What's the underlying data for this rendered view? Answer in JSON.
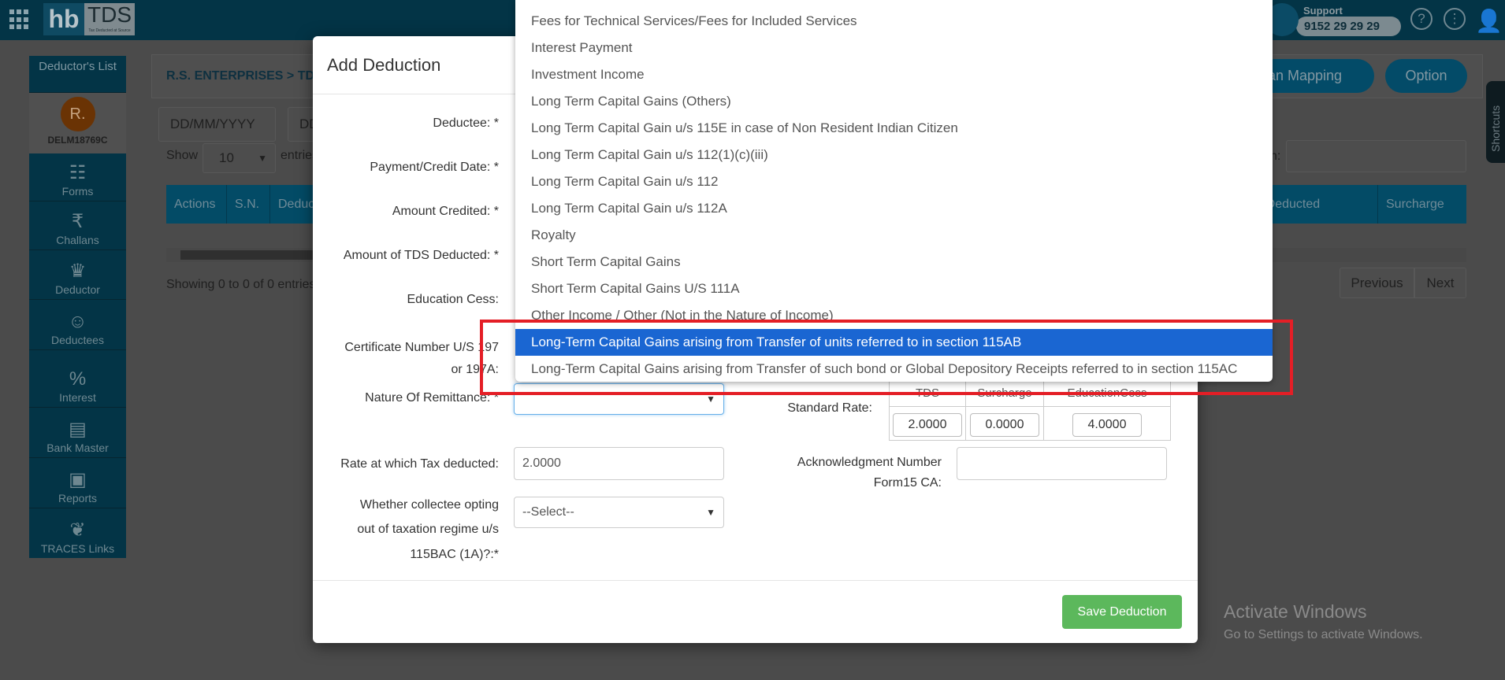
{
  "topbar": {
    "logo_hb": "hb",
    "logo_tds": "TDS",
    "logo_tagline": "Tax Deducted at Source",
    "support_label": "Support",
    "support_phone": "9152 29 29 29",
    "icons": [
      "apps-grid-icon",
      "phone-icon",
      "help-icon",
      "more-vertical-icon",
      "user-icon"
    ]
  },
  "sidebar": {
    "header": "Deductor's List",
    "avatar_initial": "R.",
    "deductor_code": "DELM18769C",
    "items": [
      {
        "label": "Forms",
        "icon": "forms-icon"
      },
      {
        "label": "Challans",
        "icon": "challan-icon"
      },
      {
        "label": "Deductor",
        "icon": "crown-icon"
      },
      {
        "label": "Deductees",
        "icon": "person-icon"
      },
      {
        "label": "Interest",
        "icon": "money-bag-icon"
      },
      {
        "label": "Bank Master",
        "icon": "bank-icon"
      },
      {
        "label": "Reports",
        "icon": "report-icon"
      },
      {
        "label": "TRACES Links",
        "icon": "traces-icon"
      }
    ]
  },
  "page": {
    "breadcrumb": "R.S. ENTERPRISES > TDS",
    "challan_mapping": "llan Mapping",
    "option": "Option",
    "date_from_placeholder": "DD/MM/YYYY",
    "date_to_placeholder": "DD/MM/YYYY",
    "show_label": "Show",
    "page_size": "10",
    "entries_label": "entries",
    "search_label": "n:",
    "columns": [
      "Actions",
      "S.N.",
      "Deduc",
      "DS Deducted",
      "Surcharge"
    ],
    "info": "Showing 0 to 0 of 0 entries",
    "previous": "Previous",
    "next": "Next",
    "shortcuts": "Shortcuts"
  },
  "modal": {
    "title": "Add Deduction",
    "labels": {
      "deductee": "Deductee: *",
      "payment_date": "Payment/Credit Date: *",
      "amount_credited": "Amount Credited: *",
      "tds_deducted": "Amount of TDS Deducted: *",
      "education_cess": "Education Cess:",
      "certificate_1": "Certificate Number U/S 197",
      "certificate_2": "or 197A:",
      "nature": "Nature Of Remittance: *",
      "rate": "Rate at which Tax deducted:",
      "opting_1": "Whether collectee opting",
      "opting_2": "out of taxation regime u/s",
      "opting_3": "115BAC (1A)?:*",
      "standard_rate": "Standard Rate:",
      "ack_1": "Acknowledgment Number",
      "ack_2": "Form15 CA:"
    },
    "rate_value": "2.0000",
    "opting_value": "--Select--",
    "nature_value": "",
    "standard": {
      "headers": [
        "TDS",
        "Surcharge",
        "EducationCess"
      ],
      "values": [
        "2.0000",
        "0.0000",
        "4.0000"
      ]
    },
    "save": "Save Deduction"
  },
  "dropdown": {
    "selected_index": 12,
    "options": [
      "Fees for Technical Services/Fees for Included Services",
      "Interest Payment",
      "Investment Income",
      "Long Term Capital Gains (Others)",
      "Long Term Capital Gain u/s 115E in case of Non Resident Indian Citizen",
      "Long Term Capital Gain u/s 112(1)(c)(iii)",
      "Long Term Capital Gain u/s 112",
      "Long Term Capital Gain u/s 112A",
      "Royalty",
      "Short Term Capital Gains",
      "Short Term Capital Gains U/S 111A",
      "Other Income / Other (Not in the Nature of Income)",
      "Long-Term Capital Gains arising from Transfer of units referred to in section 115AB",
      "Long-Term Capital Gains arising from Transfer of such bond or Global Depository Receipts referred to in section 115AC"
    ]
  },
  "annotation": {
    "color": "#e41e26"
  },
  "watermark": {
    "title": "Activate Windows",
    "subtitle": "Go to Settings to activate Windows."
  }
}
